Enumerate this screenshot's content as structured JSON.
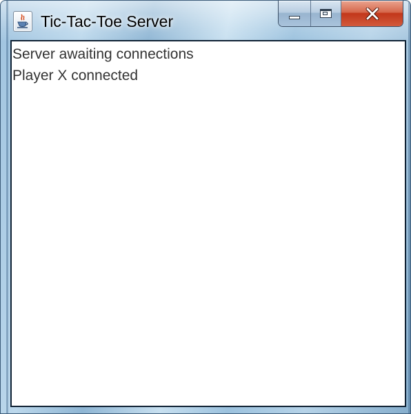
{
  "window": {
    "title": "Tic-Tac-Toe Server",
    "icon": "java-icon"
  },
  "controls": {
    "minimize": "minimize-icon",
    "maximize": "maximize-icon",
    "close": "close-icon"
  },
  "log": {
    "lines": [
      "Server awaiting connections",
      "Player X connected"
    ]
  },
  "colors": {
    "text": "#333333",
    "close_button": "#c2371a",
    "frame": "#9fc3df"
  }
}
